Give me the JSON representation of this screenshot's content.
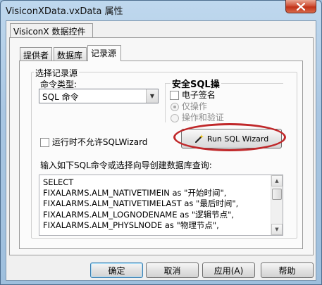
{
  "window": {
    "title": "VisiconXData.vxData 属性",
    "close_glyph": "✕"
  },
  "top_tab": {
    "label": "VisiconX 数据控件"
  },
  "tabs": [
    {
      "label": "提供者"
    },
    {
      "label": "数据库"
    },
    {
      "label": "记录源"
    }
  ],
  "record_source": {
    "group_title": "选择记录源",
    "command_type_label": "命令类型:",
    "command_type_value": "SQL 命令",
    "security": {
      "title": "安全SQL操",
      "digital_signature": "电子签名",
      "perform_only": "仅操作",
      "perform_and_verify": "操作和验证"
    },
    "runtime_wizard_label": "运行时不允许SQLWizard",
    "wizard_button": "Run SQL Wizard",
    "query_prompt": "输入如下SQL命令或选择向导创建数据库查询:",
    "sql_lines": [
      "SELECT",
      " FIXALARMS.ALM_NATIVETIMEIN as \"开始时间\",",
      "FIXALARMS.ALM_NATIVETIMELAST as \"最后时间\",",
      "FIXALARMS.ALM_LOGNODENAME as \"逻辑节点\",",
      "FIXALARMS.ALM_PHYSLNODE as \"物理节点\","
    ]
  },
  "buttons": {
    "ok": "确定",
    "cancel": "取消",
    "apply": "应用(A)",
    "help": "帮助"
  },
  "colors": {
    "highlight_ellipse": "#c0282a",
    "title_bar": "#a9c6e2"
  }
}
